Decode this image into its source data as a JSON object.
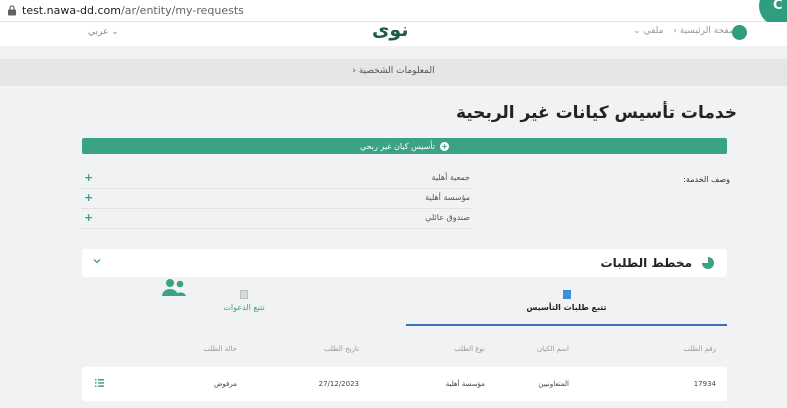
{
  "browser": {
    "url_host": "test.nawa-dd.com",
    "url_path": "/ar/entity/my-requests"
  },
  "header": {
    "language": "عربي",
    "logo": "نوى",
    "nav": [
      "الصفحة الرئيسية",
      "ملفي"
    ]
  },
  "breadcrumb": {
    "current": "المعلومات الشخصية"
  },
  "page": {
    "title": "خدمات تأسيس كيانات غير الربحية",
    "add_button": "تأسيس كيان غير ربحي",
    "description_label": "وصف الخدمة:",
    "services": [
      "جمعية أهلية",
      "مؤسسة أهلية",
      "صندوق عائلي"
    ]
  },
  "section": {
    "title": "مخطط الطلبات"
  },
  "tabs": {
    "founding": "تتبع طلبات التأسيس",
    "invites": "تتبع الدعوات"
  },
  "table": {
    "headers": {
      "number": "رقم الطلب",
      "entity_name": "اسم الكيان",
      "type": "نوع الطلب",
      "date": "تاريخ الطلب",
      "status": "حالة الطلب"
    },
    "rows": [
      {
        "number": "17934",
        "entity_name": "المتعاونيين",
        "type": "مؤسسة أهلية",
        "date": "27/12/2023",
        "status": "مرفوض"
      }
    ]
  },
  "colors": {
    "primary": "#3aa383",
    "active_tab": "#3a72b8"
  }
}
